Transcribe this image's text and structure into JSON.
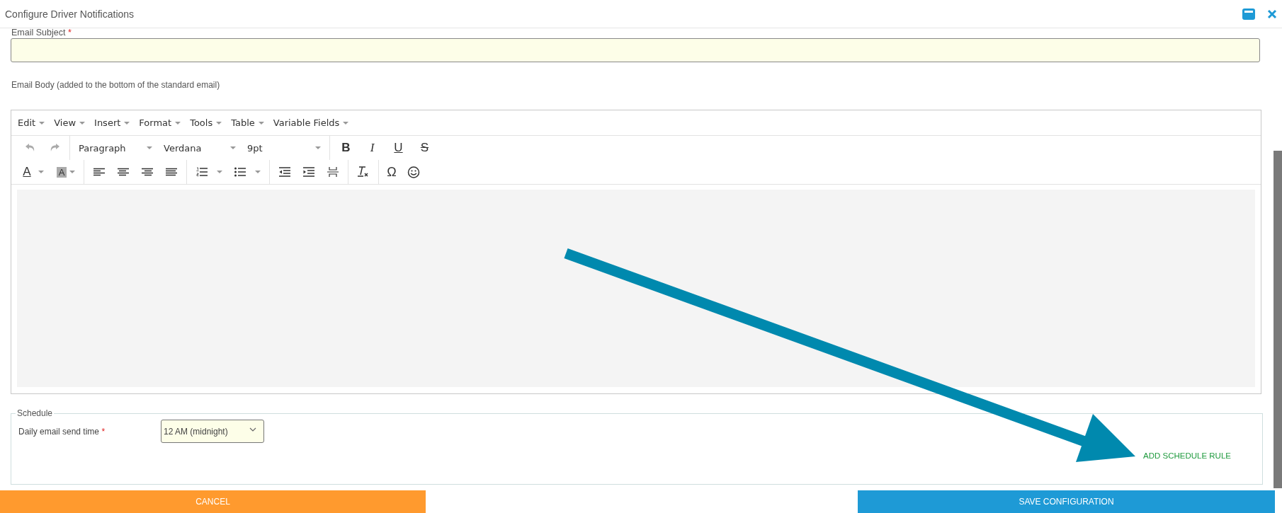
{
  "window": {
    "title": "Configure Driver Notifications"
  },
  "email_subject": {
    "label": "Email Subject",
    "required_mark": "*"
  },
  "email_body": {
    "label": "Email Body (added to the bottom of the standard email)"
  },
  "editor": {
    "menu": [
      "Edit",
      "View",
      "Insert",
      "Format",
      "Tools",
      "Table",
      "Variable Fields"
    ],
    "history": [
      {
        "disabled": true
      },
      {
        "disabled": true
      }
    ],
    "selects": [
      {
        "value": "Paragraph"
      },
      {
        "value": "Verdana"
      },
      {
        "value": "9pt"
      }
    ],
    "format_buttons": [
      "B",
      "I",
      "U",
      "S"
    ],
    "color_buttons": [
      "A",
      "A"
    ],
    "symbol_button": "Ω"
  },
  "schedule": {
    "legend": "Schedule",
    "label": "Daily email send time",
    "required_mark": "*",
    "select_value": "12 AM (midnight)",
    "add_rule": "ADD SCHEDULE RULE"
  },
  "buttons": {
    "cancel": "CANCEL",
    "save": "SAVE CONFIGURATION"
  }
}
